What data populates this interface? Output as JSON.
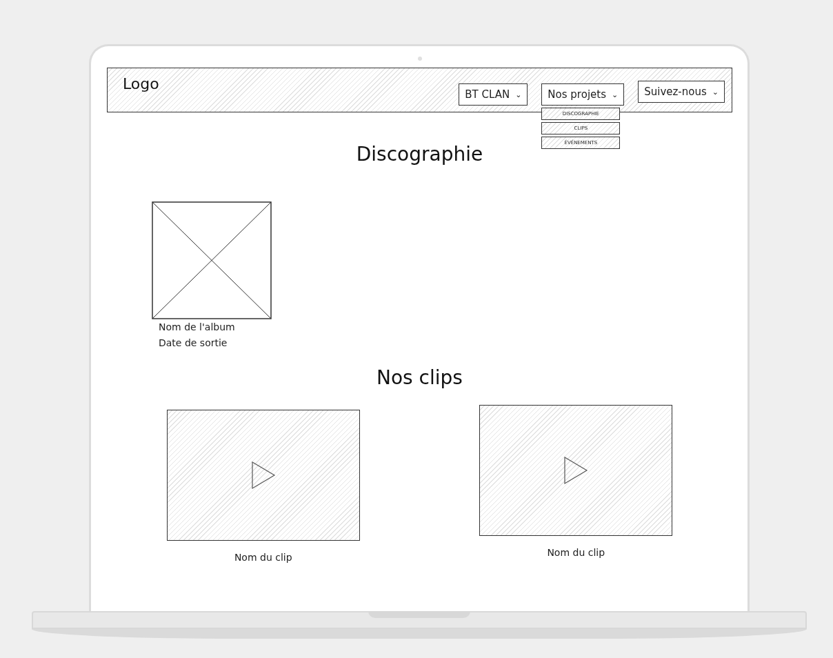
{
  "header": {
    "logo": "Logo",
    "nav": [
      {
        "label": "BT CLAN",
        "caret": "⌄"
      },
      {
        "label": "Nos projets",
        "caret": "⌄",
        "menu": [
          "DISCOGRAPHIE",
          "CLIPS",
          "ÉVÉNEMENTS"
        ]
      },
      {
        "label": "Suivez-nous",
        "caret": "⌄"
      }
    ]
  },
  "discography": {
    "title": "Discographie",
    "albums": [
      {
        "name": "Nom de l'album",
        "date": "Date de sortie"
      }
    ]
  },
  "clips": {
    "title": "Nos clips",
    "items": [
      {
        "name": "Nom du clip"
      },
      {
        "name": "Nom du clip"
      }
    ]
  }
}
